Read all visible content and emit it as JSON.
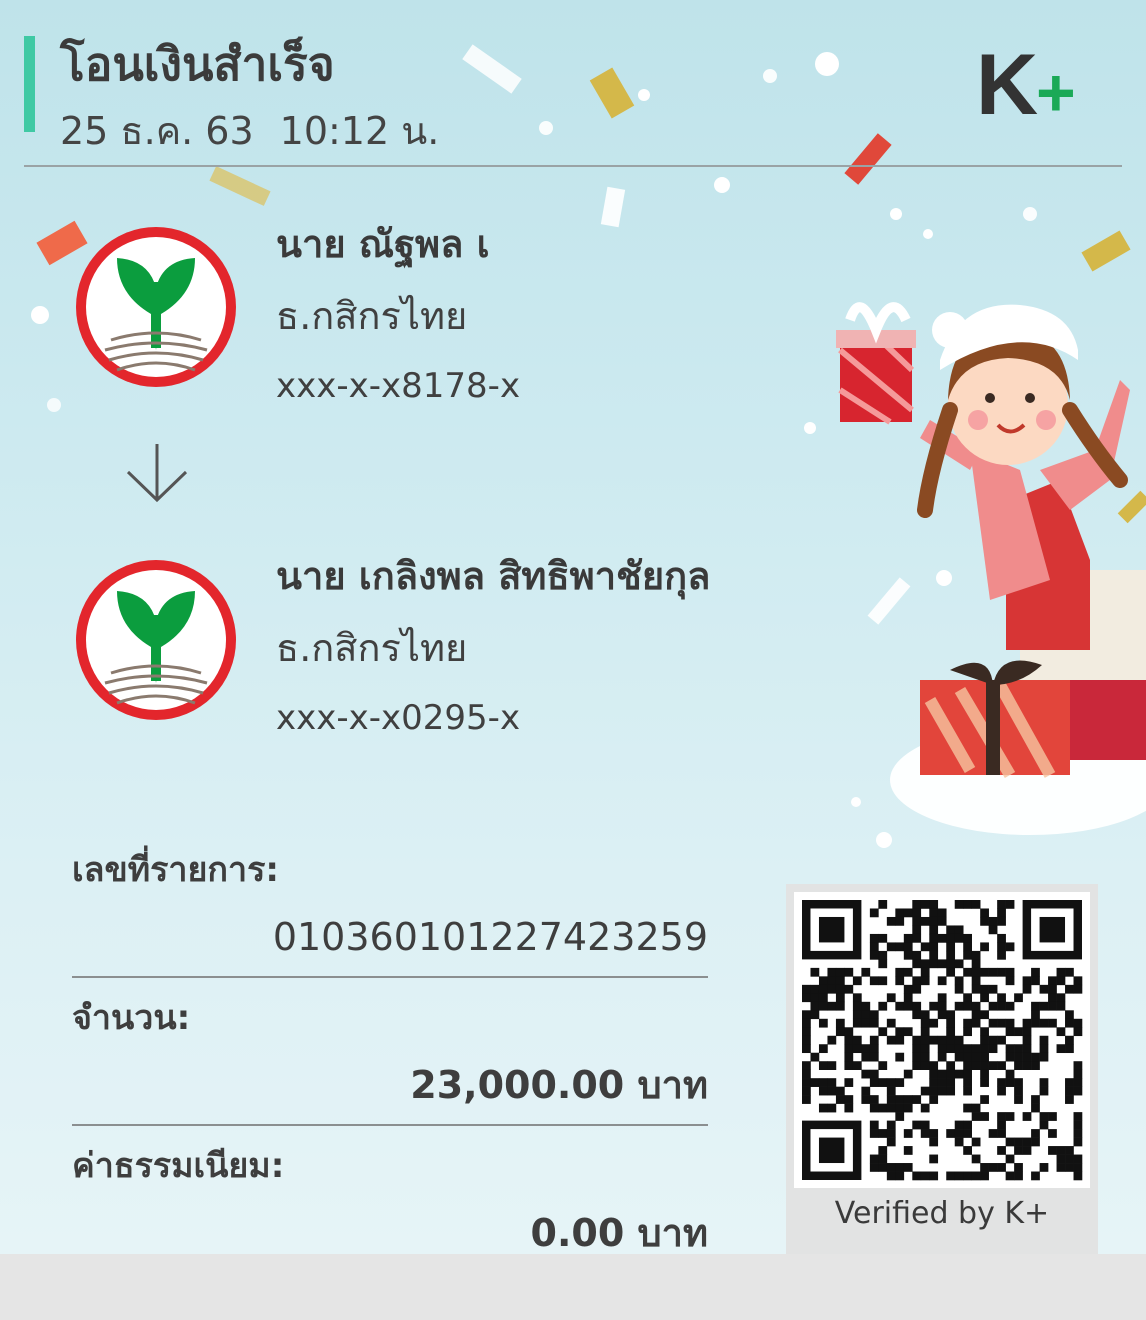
{
  "header": {
    "title": "โอนเงินสำเร็จ",
    "date": "25 ธ.ค. 63",
    "time": "10:12 น."
  },
  "brand": {
    "logo_letter": "K",
    "logo_plus": "+",
    "accent_color": "#3fc9a4",
    "bank_color": "#0b9d3e",
    "ring_color": "#e3262c"
  },
  "sender": {
    "name": "นาย ณัฐพล เ",
    "bank": "ธ.กสิกรไทย",
    "account": "xxx-x-x8178-x",
    "icon": "kasikorn-bank-logo"
  },
  "transfer_icon": "arrow-down-icon",
  "receiver": {
    "name": "นาย เกลิงพล สิทธิพาชัยกุล",
    "bank": "ธ.กสิกรไทย",
    "account": "xxx-x-x0295-x",
    "icon": "kasikorn-bank-logo"
  },
  "details": {
    "ref_label": "เลขที่รายการ:",
    "ref_value": "010360101227423259",
    "amount_label": "จำนวน:",
    "amount_value": "23,000.00 บาท",
    "fee_label": "ค่าธรรมเนียม:",
    "fee_value": "0.00 บาท"
  },
  "qr": {
    "caption": "Verified by K+"
  }
}
